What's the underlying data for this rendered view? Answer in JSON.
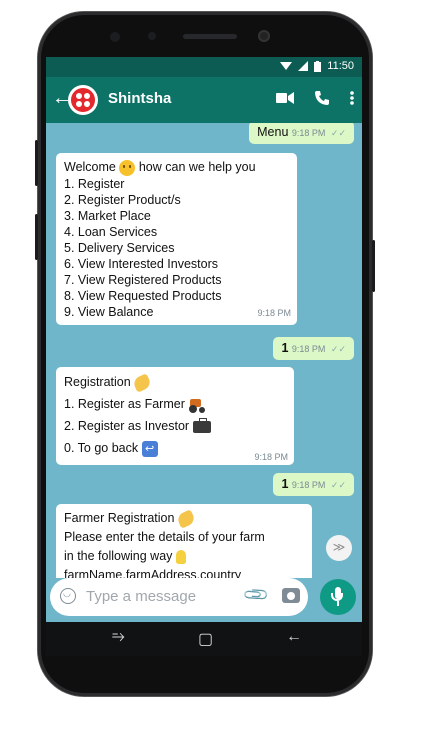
{
  "status": {
    "time": "11:50"
  },
  "header": {
    "title": "Shintsha"
  },
  "messages": {
    "m1": {
      "text": "Menu",
      "time": "9:18 PM"
    },
    "m2": {
      "greeting_before": "Welcome",
      "greeting_after": "how can we help you",
      "items": [
        "1. Register",
        "2. Register Product/s",
        "3. Market Place",
        "4. Loan Services",
        "5. Delivery Services",
        "6. View Interested Investors",
        "7. View Registered Products",
        "8. View Requested Products",
        "9. View Balance"
      ],
      "time": "9:18 PM"
    },
    "m3": {
      "text": "1",
      "time": "9:18 PM"
    },
    "m4": {
      "title": "Registration",
      "line1": "1. Register as Farmer",
      "line2": "2. Register as Investor",
      "line3": "0. To go back",
      "time": "9:18 PM"
    },
    "m5": {
      "text": "1",
      "time": "9:18 PM"
    },
    "m6": {
      "title": "Farmer Registration",
      "line1": " Please enter the details of your farm",
      "line2": "in the following way",
      "line3": "farmName,farmAddress,country"
    }
  },
  "composer": {
    "placeholder": "Type a message"
  },
  "icons": {
    "back": "arrow-left-icon",
    "video": "video-camera-icon",
    "call": "phone-icon",
    "menu": "more-vert-icon",
    "emoji": "emoji-icon",
    "attach": "paperclip-icon",
    "camera": "camera-icon",
    "mic": "microphone-icon",
    "scroll": "double-chevron-down-icon"
  },
  "colors": {
    "header": "#0e7367",
    "statusbar": "#0d5c54",
    "chat_bg": "#6fb6cb",
    "outgoing": "#dcf8c6",
    "incoming": "#ffffff",
    "mic": "#0e9a84"
  }
}
